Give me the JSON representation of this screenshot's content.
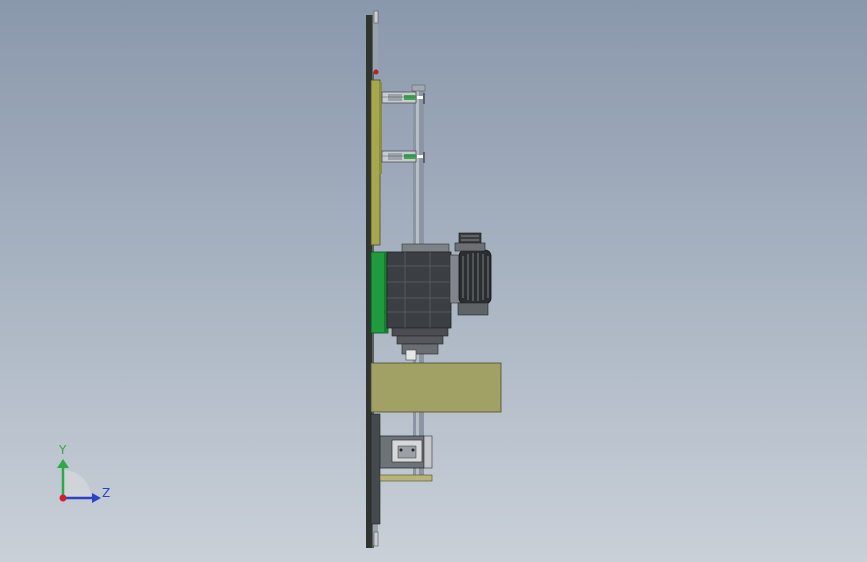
{
  "viewport": {
    "view_type": "cad-3d-model-side-view",
    "background_top": "#8a98ac",
    "background_bottom": "#c9d0d8"
  },
  "triad": {
    "y_label": "Y",
    "z_label": "Z",
    "y_color": "#2fa84a",
    "z_color": "#2b43c6",
    "x_color": "#d0202a"
  },
  "model_colors": {
    "backplate": "#2f3430",
    "olive_plate": "#a7a84e",
    "green_mount": "#1f9a3c",
    "shaft": "#8c96a2",
    "gearbox_dark": "#3b3e42",
    "motor_dark": "#2b2e31",
    "khaki_block": "#a2a165",
    "bracket_gray": "#6e7378"
  }
}
